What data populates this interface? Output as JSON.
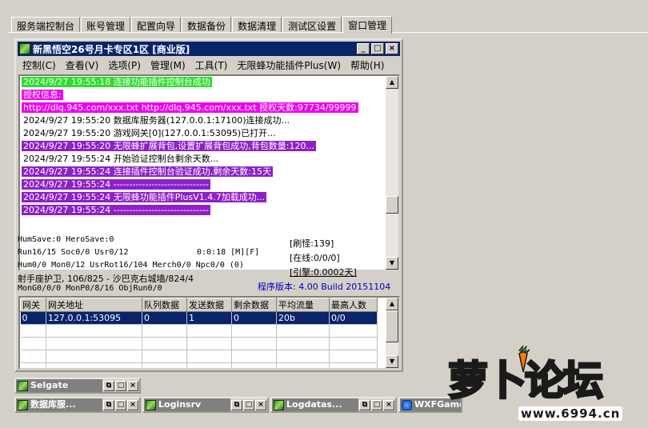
{
  "tabs": [
    {
      "label": "服务端控制台"
    },
    {
      "label": "账号管理"
    },
    {
      "label": "配置向导"
    },
    {
      "label": "数据备份"
    },
    {
      "label": "数据清理"
    },
    {
      "label": "测试区设置"
    },
    {
      "label": "窗口管理"
    }
  ],
  "window": {
    "title": "新黑悟空26号月卡专区1区 [商业版]",
    "buttons": {
      "minimize": "_",
      "maximize": "□",
      "close": "×"
    }
  },
  "menu": [
    {
      "label": "控制(C)"
    },
    {
      "label": "查看(V)"
    },
    {
      "label": "选项(P)"
    },
    {
      "label": "管理(M)"
    },
    {
      "label": "工具(T)"
    },
    {
      "label": "无限蜂功能插件Plus(W)"
    },
    {
      "label": "帮助(H)"
    }
  ],
  "log": [
    {
      "text": "2024/9/27 19:55:18 连接功能插件控制台成功",
      "style": "green"
    },
    {
      "text": "授权信息:",
      "style": "magenta"
    },
    {
      "text": "http://dlq.945.com/xxx.txt http://dlq.945.com/xxx.txt 授权天数:97734/99999",
      "style": "magenta"
    },
    {
      "text": "2024/9/27 19:55:20 数据库服务器(127.0.0.1:17100)连接成功...",
      "style": "plain"
    },
    {
      "text": "2024/9/27 19:55:20 游戏网关[0](127.0.0.1:53095)已打开...",
      "style": "plain"
    },
    {
      "text": "2024/9/27 19:55:20 无限蜂扩展背包,设置扩展背包成功,背包数量:120...",
      "style": "purple"
    },
    {
      "text": "2024/9/27 19:55:24 开始验证控制台剩余天数...",
      "style": "plain"
    },
    {
      "text": "2024/9/27 19:55:24 连接插件控制台验证成功,剩余天数:15天",
      "style": "purple"
    },
    {
      "text": "2024/9/27 19:55:24 ------------------------------",
      "style": "purple"
    },
    {
      "text": "2024/9/27 19:55:24 无限蜂功能插件PlusV1.4.7加载成功...",
      "style": "purple"
    },
    {
      "text": "2024/9/27 19:55:24 ------------------------------",
      "style": "purple"
    }
  ],
  "log_scroll": {
    "up": "▲",
    "down": "▼"
  },
  "status": {
    "line1": "HumSave:0 HeroSave:0",
    "line2": "Run16/15 Soc0/0 Usr0/12",
    "line3": "Hum0/0 Mon0/12 UsrRot16/104 Merch0/0 Npc0/0 (0)",
    "line4": "射手座护卫, 106/825 - 沙巴克右城墙/824/4",
    "line5": "MonG0/0/0 MonP0/8/16 ObjRun0/0",
    "timer": "0:0:18 [M][F]",
    "refresh": "[刷怪:139]",
    "online": "[在线:0/0/0]",
    "engine": "[引擎:0.0002天]",
    "version": "程序版本: 4.00 Build 20151104"
  },
  "gateway_table": {
    "headers": [
      "网关",
      "网关地址",
      "队列数据",
      "发送数据",
      "剩余数据",
      "平均流量",
      "最高人数"
    ],
    "rows": [
      [
        "0",
        "127.0.0.1:53095",
        "0",
        "1",
        "0",
        "20b",
        "0/0"
      ]
    ]
  },
  "minimized_windows": [
    {
      "title": "Selgate"
    },
    {
      "title": "数据库服..."
    },
    {
      "title": "Loginsrv"
    },
    {
      "title": "Logdatas..."
    },
    {
      "title": "WXFGameOfM"
    }
  ],
  "logo": {
    "text": "萝卜论坛",
    "url": "www.6994.cn"
  }
}
